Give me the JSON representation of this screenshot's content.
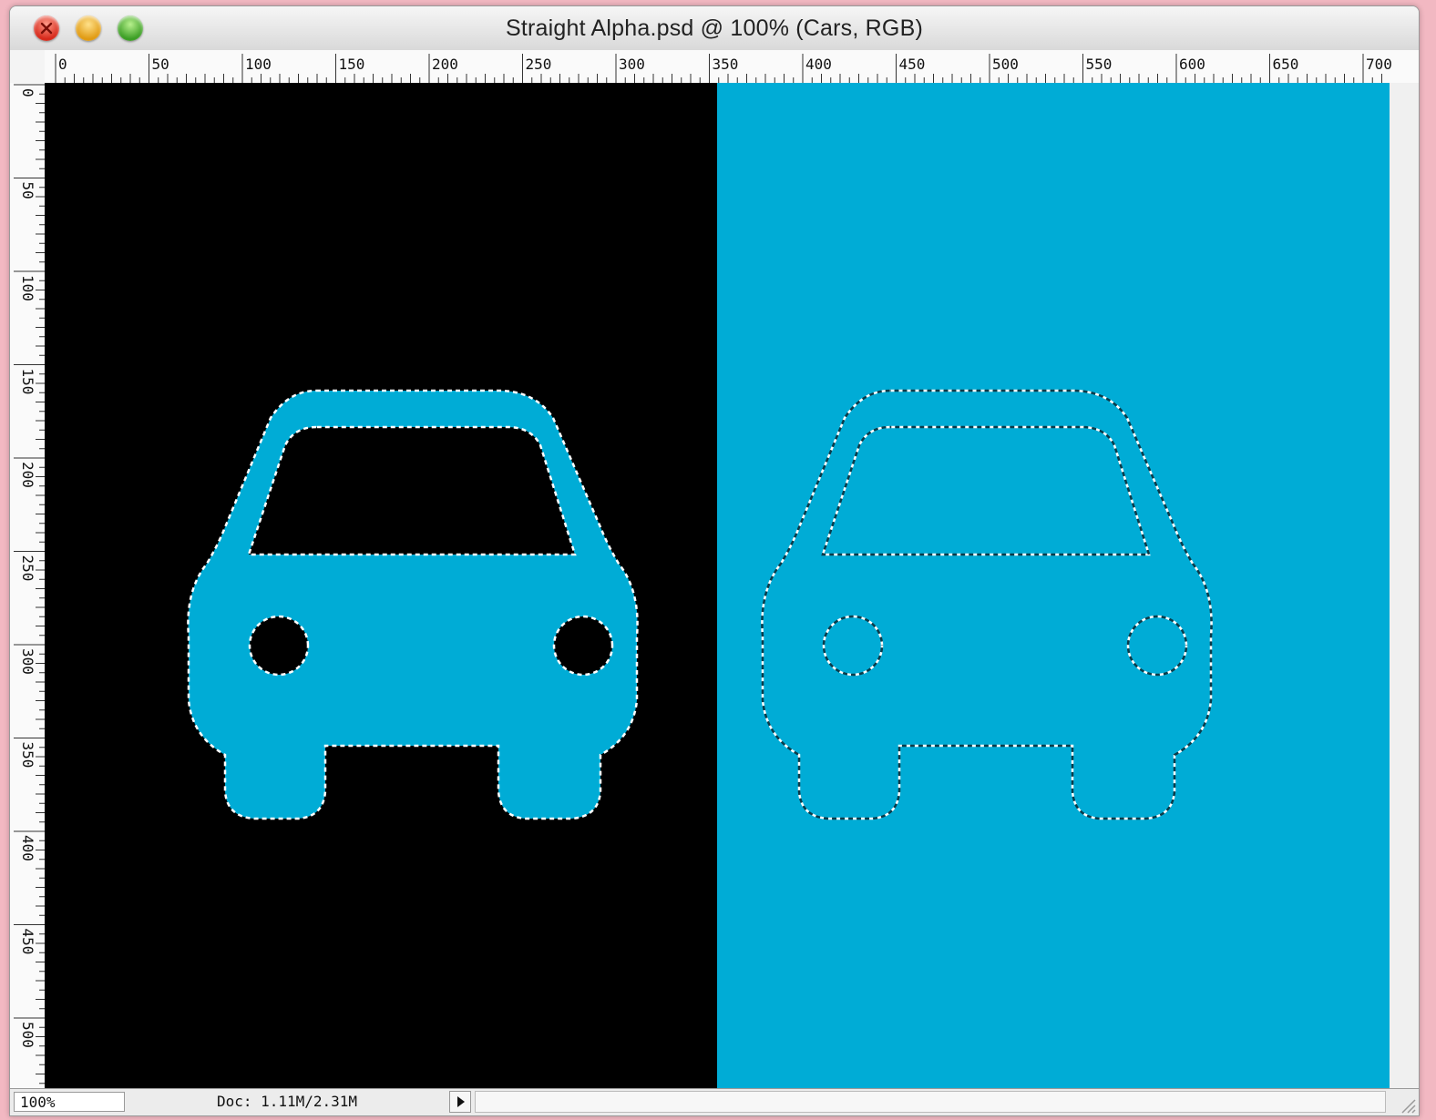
{
  "window": {
    "title": "Straight Alpha.psd @ 100% (Cars, RGB)"
  },
  "rulers": {
    "horizontal_ticks": [
      "0",
      "50",
      "100",
      "150",
      "200",
      "250",
      "300",
      "350",
      "400",
      "450",
      "500",
      "550",
      "600",
      "650",
      "700"
    ],
    "vertical_ticks": [
      "0",
      "50",
      "100",
      "150",
      "200",
      "250",
      "300",
      "350",
      "400",
      "450",
      "500"
    ]
  },
  "canvas": {
    "left_background": "#000000",
    "right_background": "#00acd6",
    "car_color": "#00acd6"
  },
  "status": {
    "zoom": "100%",
    "doc": "Doc: 1.11M/2.31M"
  }
}
